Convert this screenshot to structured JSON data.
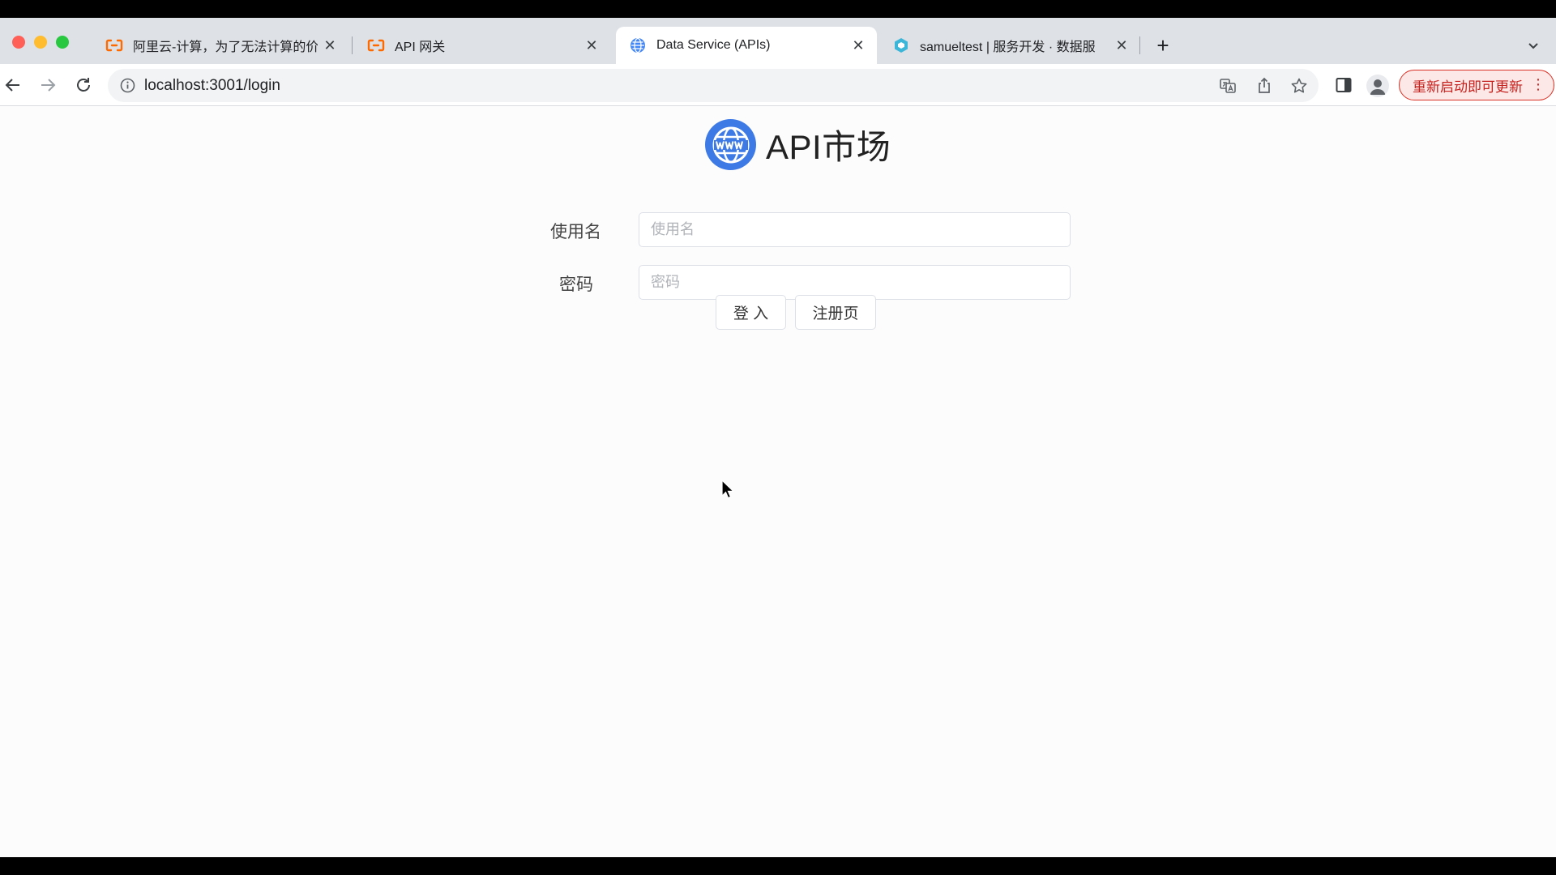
{
  "browser": {
    "tabs": [
      {
        "title": "阿里云-计算，为了无法计算的价",
        "favicon": "aliyun-icon",
        "active": false
      },
      {
        "title": "API 网关",
        "favicon": "aliyun-icon",
        "active": false
      },
      {
        "title": "Data Service (APIs)",
        "favicon": "globe-icon",
        "active": true
      },
      {
        "title": "samueltest | 服务开发 · 数据服",
        "favicon": "dataworks-icon",
        "active": false
      }
    ],
    "new_tab_label": "+",
    "url": "localhost:3001/login",
    "update_button_label": "重新启动即可更新",
    "accent_color": "#d93025"
  },
  "page": {
    "brand_title": "API市场",
    "brand_logo_icon": "www-globe-icon",
    "brand_color": "#3e7ae6",
    "username": {
      "label": "使用名",
      "placeholder": "使用名",
      "value": ""
    },
    "password": {
      "label": "密码",
      "placeholder": "密码",
      "value": ""
    },
    "login_button_label": "登 入",
    "register_button_label": "注册页"
  }
}
